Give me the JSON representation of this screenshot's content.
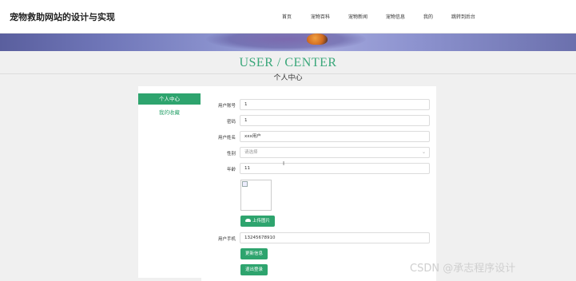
{
  "header": {
    "site_title": "宠物救助网站的设计与实现",
    "nav": [
      "首页",
      "宠物百科",
      "宠物新闻",
      "宠物信息",
      "我的",
      "跳转到后台"
    ]
  },
  "section": {
    "title": "USER / CENTER",
    "subtitle": "个人中心"
  },
  "sidebar": {
    "items": [
      "个人中心",
      "我的收藏"
    ]
  },
  "form": {
    "account_label": "用户账号",
    "account_value": "1",
    "password_label": "密码",
    "password_value": "1",
    "name_label": "用户姓名",
    "name_value": "xxx用户",
    "gender_label": "性别",
    "gender_placeholder": "请选择",
    "age_label": "年龄",
    "age_value": "11",
    "upload_label": "上传图片",
    "phone_label": "用户手机",
    "phone_value": "13245678910",
    "update_label": "更新信息",
    "logout_label": "退出登录"
  },
  "watermark": "CSDN @承志程序设计",
  "colors": {
    "accent": "#2ea46e",
    "title_green": "#3aa77a"
  }
}
